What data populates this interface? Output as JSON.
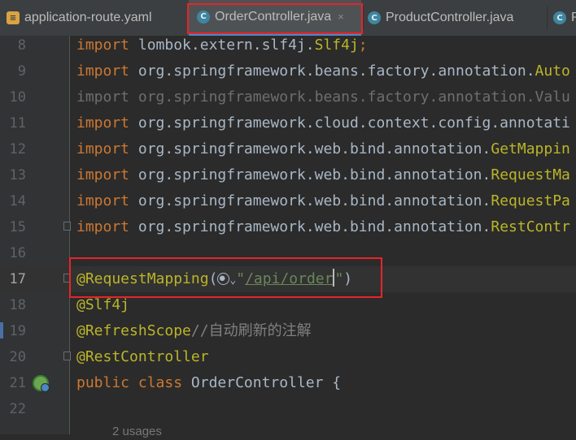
{
  "tabs": [
    {
      "label": "application-route.yaml",
      "icon": "yaml-file-icon",
      "active": false
    },
    {
      "label": "OrderController.java",
      "icon": "java-class-icon",
      "active": true
    },
    {
      "label": "ProductController.java",
      "icon": "java-class-icon",
      "active": false
    },
    {
      "label": "P",
      "icon": "java-class-icon",
      "active": false
    }
  ],
  "close_glyph": "×",
  "lines": [
    {
      "num": "8",
      "parts": [
        "import",
        " lombok.extern.slf4j.",
        "Slf4j",
        ";"
      ]
    },
    {
      "num": "9",
      "parts": [
        "import",
        " org.springframework.beans.factory.annotation.",
        "Auto"
      ]
    },
    {
      "num": "10",
      "parts": [
        "import",
        " org.springframework.beans.factory.annotation.",
        "Valu"
      ]
    },
    {
      "num": "11",
      "parts": [
        "import",
        " org.springframework.cloud.context.config.annotati"
      ]
    },
    {
      "num": "12",
      "parts": [
        "import",
        " org.springframework.web.bind.annotation.",
        "GetMappin"
      ]
    },
    {
      "num": "13",
      "parts": [
        "import",
        " org.springframework.web.bind.annotation.",
        "RequestMa"
      ]
    },
    {
      "num": "14",
      "parts": [
        "import",
        " org.springframework.web.bind.annotation.",
        "RequestPa"
      ]
    },
    {
      "num": "15",
      "parts": [
        "import",
        " org.springframework.web.bind.annotation.",
        "RestContr"
      ]
    },
    {
      "num": "16",
      "parts": []
    },
    {
      "num": "17",
      "parts": [
        "@RequestMapping",
        "(",
        "\"",
        "/api/",
        "order",
        "\"",
        ")"
      ]
    },
    {
      "num": "18",
      "parts": [
        "@Slf4j"
      ]
    },
    {
      "num": "19",
      "parts": [
        "@RefreshScope",
        "//自动刷新的注解"
      ]
    },
    {
      "num": "20",
      "parts": [
        "@RestController"
      ]
    },
    {
      "num": "21",
      "parts": [
        "public",
        " ",
        "class",
        " OrderController {"
      ]
    },
    {
      "num": "22",
      "parts": []
    }
  ],
  "usages_hint": "2 usages",
  "colors": {
    "keyword": "#cc7832",
    "annotation": "#bbb529",
    "string": "#6a8759",
    "comment": "#808080",
    "highlight_box": "#e8242a"
  }
}
